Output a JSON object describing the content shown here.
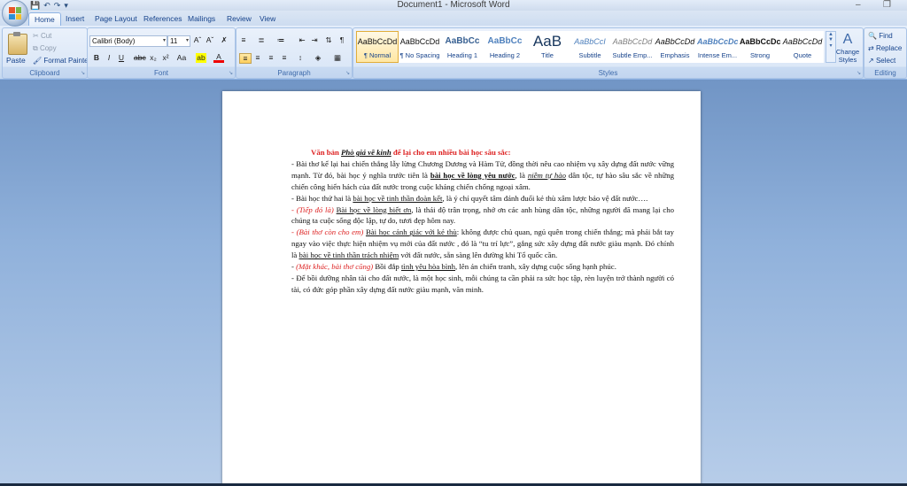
{
  "window": {
    "title": "Document1 - Microsoft Word",
    "minimize": "–",
    "restore": "❐"
  },
  "tabs": [
    "Home",
    "Insert",
    "Page Layout",
    "References",
    "Mailings",
    "Review",
    "View"
  ],
  "clipboard": {
    "label": "Clipboard",
    "paste": "Paste",
    "cut": "Cut",
    "copy": "Copy",
    "format_painter": "Format Painter"
  },
  "font": {
    "label": "Font",
    "family": "Calibri (Body)",
    "size": "11"
  },
  "paragraph": {
    "label": "Paragraph"
  },
  "styles": {
    "label": "Styles",
    "items": [
      {
        "sample": "AaBbCcDd",
        "name": "¶ Normal"
      },
      {
        "sample": "AaBbCcDd",
        "name": "¶ No Spacing"
      },
      {
        "sample": "AaBbCc",
        "name": "Heading 1"
      },
      {
        "sample": "AaBbCc",
        "name": "Heading 2"
      },
      {
        "sample": "AaB",
        "name": "Title"
      },
      {
        "sample": "AaBbCcI",
        "name": "Subtitle"
      },
      {
        "sample": "AaBbCcDd",
        "name": "Subtle Emp..."
      },
      {
        "sample": "AaBbCcDd",
        "name": "Emphasis"
      },
      {
        "sample": "AaBbCcDc",
        "name": "Intense Em..."
      },
      {
        "sample": "AaBbCcDc",
        "name": "Strong"
      },
      {
        "sample": "AaBbCcDd",
        "name": "Quote"
      }
    ],
    "change_styles": "Change Styles"
  },
  "editing": {
    "label": "Editing",
    "find": "Find",
    "replace": "Replace",
    "select": "Select"
  },
  "document": {
    "heading_a": "Văn bản ",
    "heading_b": "Phò giá về kinh",
    "heading_c": " để lại cho em nhiều bài học sâu sắc:",
    "p1_a": "- Bài thơ kể lại hai chiến thắng lẫy lừng Chương Dương và Hàm Tử, đồng thời nêu cao nhiệm vụ xây dựng đất nước vững mạnh. Từ đó, bài học ý nghĩa trước tiên là ",
    "p1_b": "bài học về lòng yêu nước",
    "p1_c": ", là ",
    "p1_d": "niềm tự hào",
    "p1_e": "  dân tộc, tự hào sâu sắc về những chiến công hiển hách của đất nước trong cuộc kháng chiến chống ngoại xâm.",
    "p2_a": "- Bài học thứ hai là ",
    "p2_b": "bài học về tinh thần đoàn kết",
    "p2_c": ", là ý chí quyết tâm đánh đuổi kẻ thù xâm lược bảo vệ đất nước….",
    "p3_a": "- (Tiếp đó là) ",
    "p3_b": "Bài học về lòng biết ơn",
    "p3_c": ", là thái độ trân trọng, nhớ ơn các anh hùng dân tộc, những người đã mang lại cho chúng ta cuộc sống độc lập, tự do, tươi đẹp hôm nay.",
    "p4_a": "- (Bài thơ còn cho em)  ",
    "p4_b": "Bài học cảnh giác với kẻ thù",
    "p4_c": ": không được chủ quan, ngủ quên trong chiến thắng; mà phải bắt tay ngay vào việc thực hiện nhiệm vụ mới của đất nước , đó là “tu trí lực”, gắng sức xây dựng đất nước giàu mạnh.  Đó chính là ",
    "p4_d": "bài học về tinh thần trách nhiệm",
    "p4_e": " với đất nước,  sẵn sàng lên đường khi Tổ quốc cần.",
    "p5_a": "-  ",
    "p5_b": "(Mặt khác, bài thơ cũng)",
    "p5_c": " Bồi đắp ",
    "p5_d": "tình yêu hòa bình",
    "p5_e": ", lên án chiến tranh, xây dựng cuộc sống hạnh phúc.",
    "p6": "-  Để bồi dưỡng nhân tài cho đất nước, là một học sinh, mỗi chúng ta cần phải ra sức học tập, rèn luyện trở thành người có tài, có đức góp phần xây dựng đất nước giàu mạnh, văn minh."
  }
}
